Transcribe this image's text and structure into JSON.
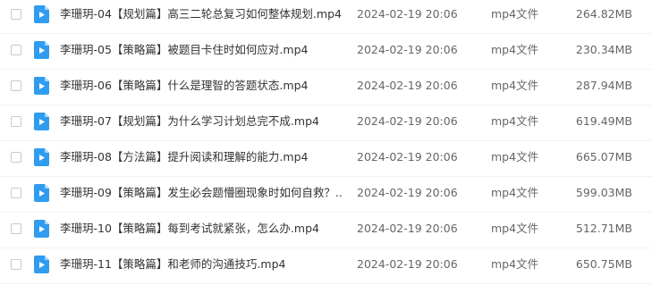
{
  "files": [
    {
      "name": "李珊玥-04【规划篇】高三二轮总复习如何整体规划.mp4",
      "date": "2024-02-19 20:06",
      "type": "mp4文件",
      "size": "264.82MB",
      "icon": "video-file-icon"
    },
    {
      "name": "李珊玥-05【策略篇】被题目卡住时如何应对.mp4",
      "date": "2024-02-19 20:06",
      "type": "mp4文件",
      "size": "230.34MB",
      "icon": "video-file-icon"
    },
    {
      "name": "李珊玥-06【策略篇】什么是理智的答题状态.mp4",
      "date": "2024-02-19 20:06",
      "type": "mp4文件",
      "size": "287.94MB",
      "icon": "video-file-icon"
    },
    {
      "name": "李珊玥-07【规划篇】为什么学习计划总完不成.mp4",
      "date": "2024-02-19 20:06",
      "type": "mp4文件",
      "size": "619.49MB",
      "icon": "video-file-icon"
    },
    {
      "name": "李珊玥-08【方法篇】提升阅读和理解的能力.mp4",
      "date": "2024-02-19 20:06",
      "type": "mp4文件",
      "size": "665.07MB",
      "icon": "video-file-icon"
    },
    {
      "name": "李珊玥-09【策略篇】发生必会题懵圈现象时如何自救？....",
      "date": "2024-02-19 20:06",
      "type": "mp4文件",
      "size": "599.03MB",
      "icon": "video-file-icon"
    },
    {
      "name": "李珊玥-10【策略篇】每到考试就紧张，怎么办.mp4",
      "date": "2024-02-19 20:06",
      "type": "mp4文件",
      "size": "512.71MB",
      "icon": "video-file-icon"
    },
    {
      "name": "李珊玥-11【策略篇】和老师的沟通技巧.mp4",
      "date": "2024-02-19 20:06",
      "type": "mp4文件",
      "size": "650.75MB",
      "icon": "video-file-icon"
    }
  ],
  "colors": {
    "icon_blue": "#2f9cf0",
    "icon_fold": "#a9d6fa"
  }
}
